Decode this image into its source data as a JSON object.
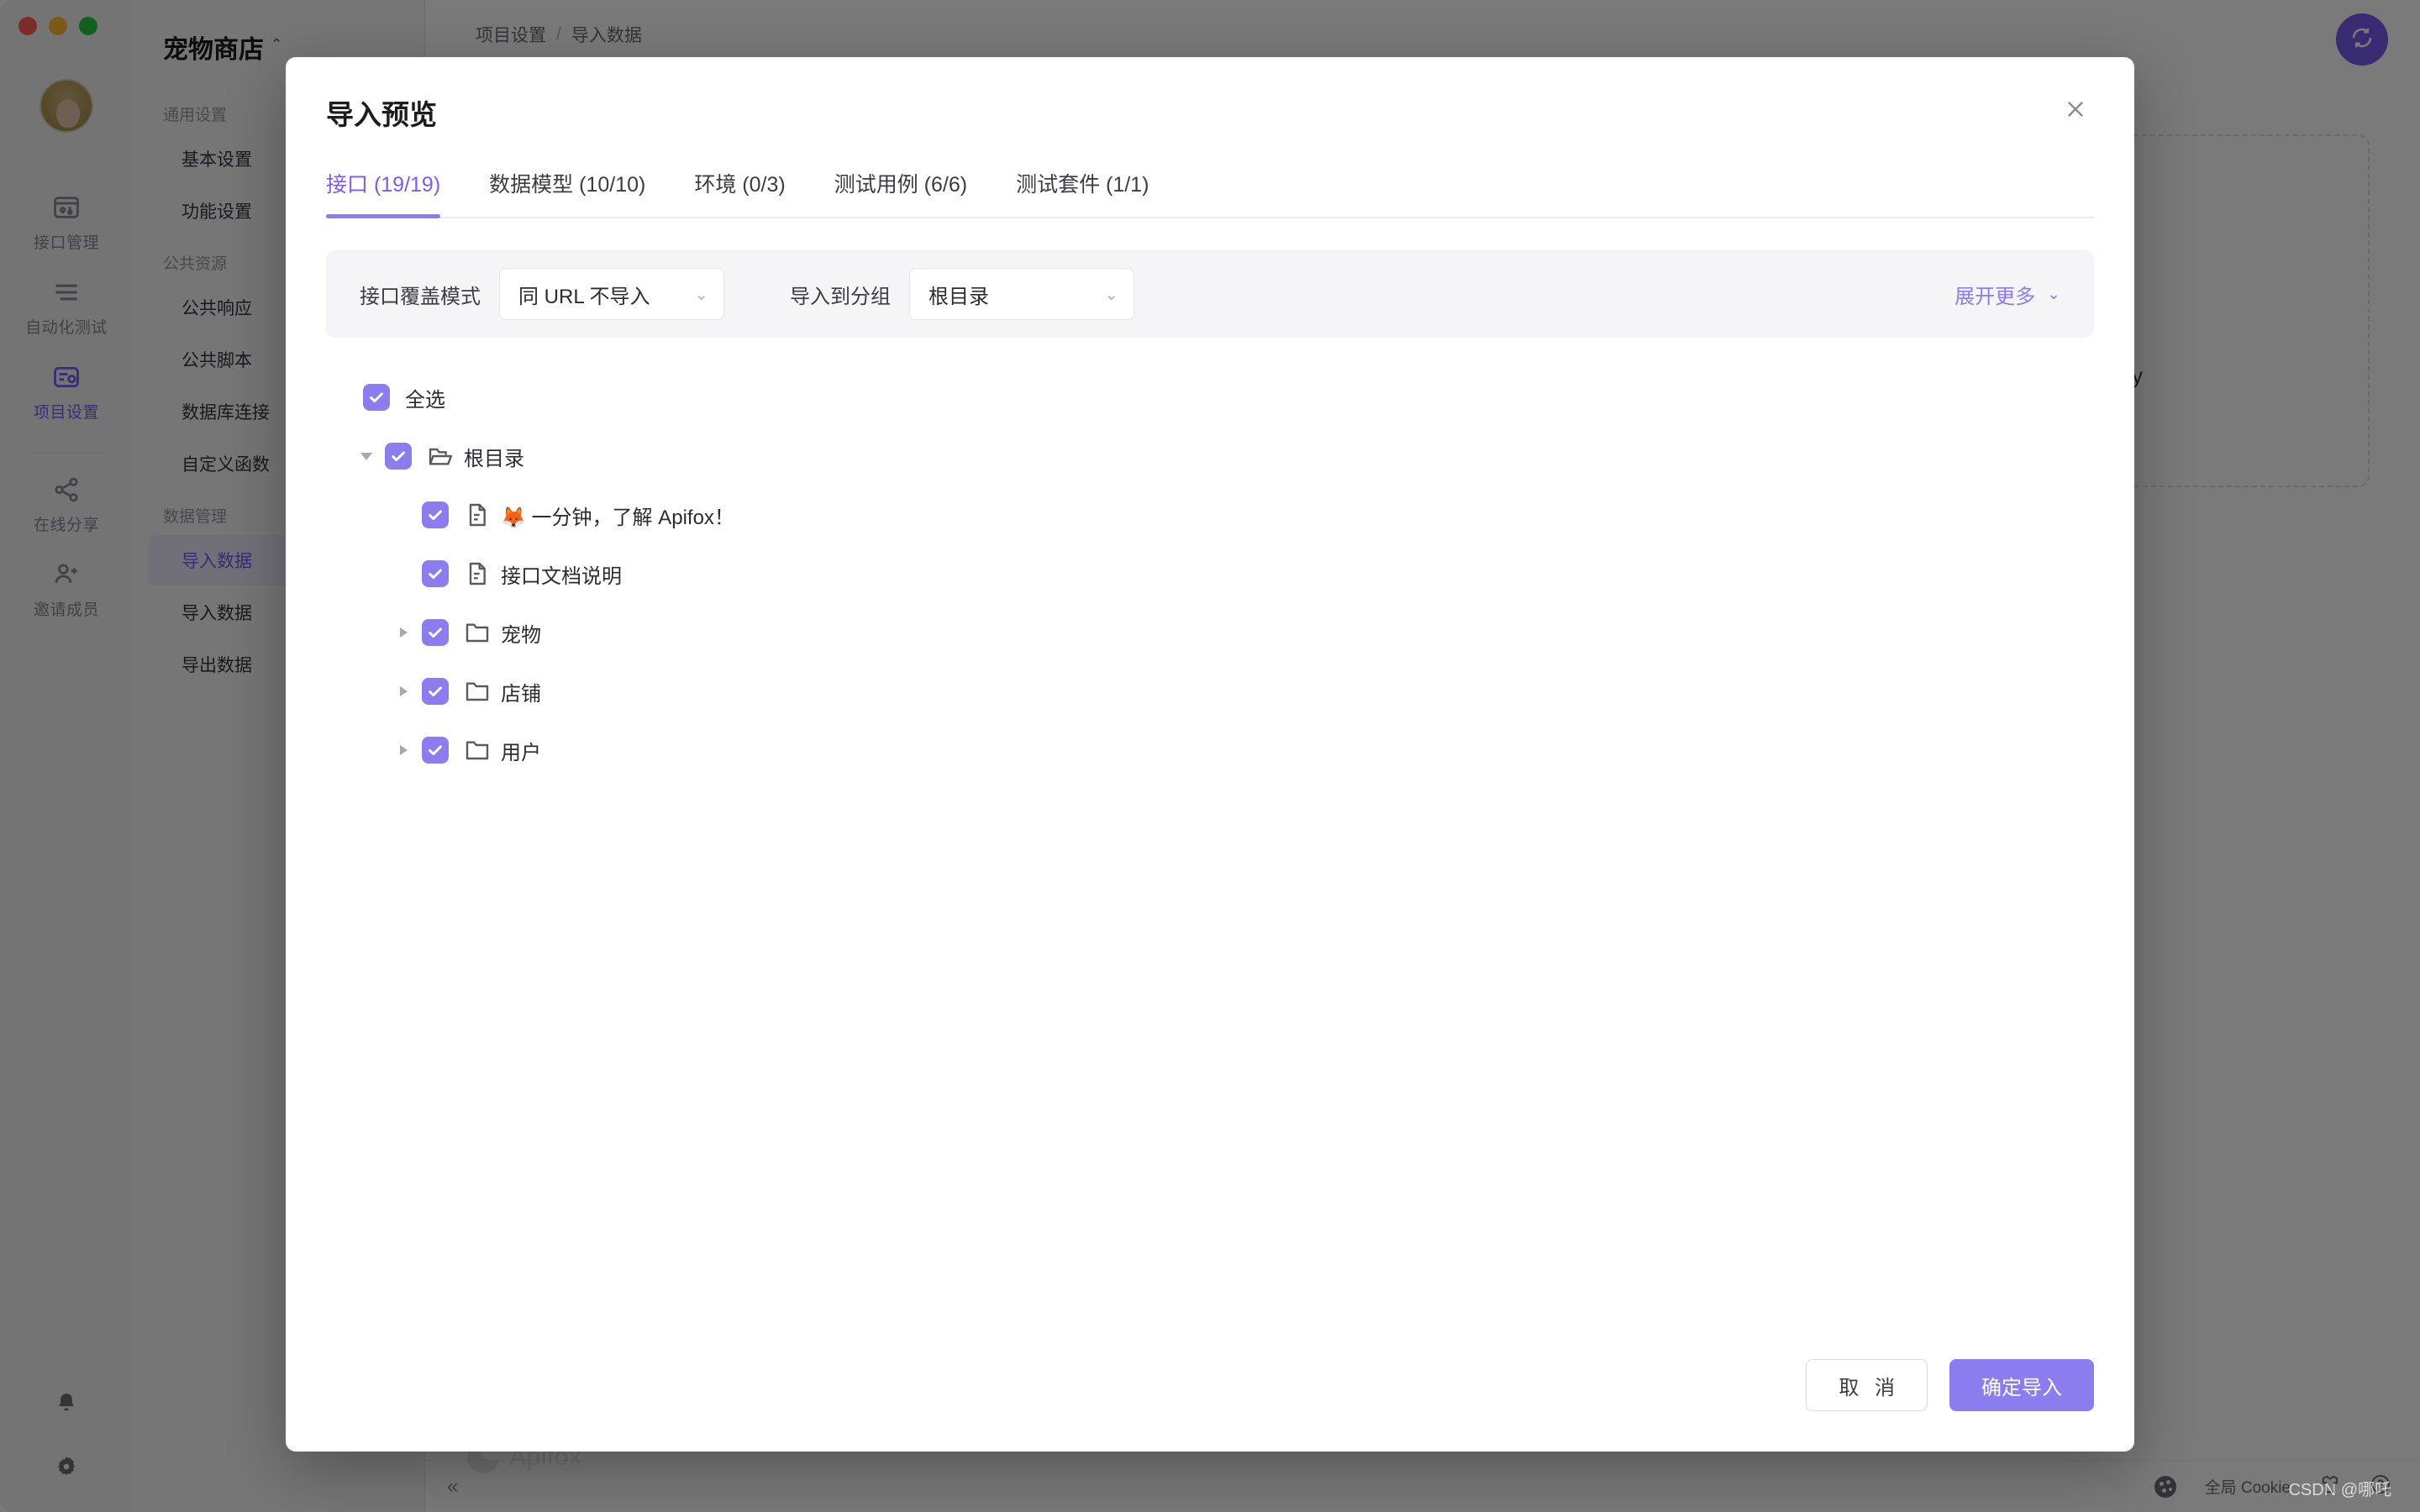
{
  "window": {
    "traffic_lights": [
      "close",
      "minimize",
      "zoom"
    ]
  },
  "rail": {
    "items": [
      {
        "label": "接口管理",
        "icon": "api-icon",
        "active": false
      },
      {
        "label": "自动化测试",
        "icon": "automation-test-icon",
        "active": false
      },
      {
        "label": "项目设置",
        "icon": "project-settings-icon",
        "active": true
      },
      {
        "label": "在线分享",
        "icon": "share-icon",
        "active": false
      },
      {
        "label": "邀请成员",
        "icon": "invite-member-icon",
        "active": false
      }
    ],
    "bottom_icons": [
      "bell-icon",
      "gear-icon"
    ]
  },
  "settings_panel": {
    "project_name": "宠物商店",
    "groups": [
      {
        "label": "通用设置",
        "items": [
          {
            "label": "基本设置",
            "active": false
          },
          {
            "label": "功能设置",
            "active": false
          }
        ]
      },
      {
        "label": "公共资源",
        "items": [
          {
            "label": "公共响应",
            "active": false
          },
          {
            "label": "公共脚本",
            "active": false
          },
          {
            "label": "数据库连接",
            "active": false
          },
          {
            "label": "自定义函数",
            "active": false
          }
        ]
      },
      {
        "label": "数据管理",
        "items": [
          {
            "label": "导入数据",
            "active": true
          },
          {
            "label": "导入数据",
            "active": false
          },
          {
            "label": "导出数据",
            "active": false
          }
        ]
      }
    ]
  },
  "main": {
    "breadcrumb": {
      "parent": "项目设置",
      "separator": "/",
      "current": "导入数据"
    },
    "sync_button_icon": "sync-icon",
    "discovery_text": "very",
    "logo_word": "Apifox"
  },
  "statusbar": {
    "collapse_icon": "collapse-left-icon",
    "cookie_label": "全局 Cookie",
    "icons": [
      "shirt-icon",
      "help-icon"
    ]
  },
  "watermark": "CSDN @哪吒",
  "modal": {
    "title": "导入预览",
    "close_icon": "close-icon",
    "tabs": [
      {
        "label": "接口 (19/19)",
        "active": true
      },
      {
        "label": "数据模型 (10/10)",
        "active": false
      },
      {
        "label": "环境 (0/3)",
        "active": false
      },
      {
        "label": "测试用例 (6/6)",
        "active": false
      },
      {
        "label": "测试套件 (1/1)",
        "active": false
      }
    ],
    "options": {
      "overwrite_label": "接口覆盖模式",
      "overwrite_value": "同 URL 不导入",
      "group_label": "导入到分组",
      "group_value": "根目录",
      "expand_more_label": "展开更多",
      "chevron": "⌄"
    },
    "tree": {
      "select_all_label": "全选",
      "nodes": [
        {
          "label": "根目录",
          "type": "folder-open",
          "indent": 1,
          "arrow": "open",
          "checked": true
        },
        {
          "label": "🦊 一分钟，了解 Apifox！",
          "type": "doc",
          "indent": 2,
          "arrow": "none",
          "checked": true
        },
        {
          "label": "接口文档说明",
          "type": "doc",
          "indent": 2,
          "arrow": "none",
          "checked": true
        },
        {
          "label": "宠物",
          "type": "folder",
          "indent": 2,
          "arrow": "closed",
          "checked": true
        },
        {
          "label": "店铺",
          "type": "folder",
          "indent": 2,
          "arrow": "closed",
          "checked": true
        },
        {
          "label": "用户",
          "type": "folder",
          "indent": 2,
          "arrow": "closed",
          "checked": true
        }
      ]
    },
    "footer": {
      "cancel_label": "取 消",
      "confirm_label": "确定导入"
    }
  },
  "colors": {
    "accent": "#8b7cf0",
    "accent_dark": "#7a5cf0",
    "text": "#2c2c32",
    "muted": "#8a8a92"
  }
}
